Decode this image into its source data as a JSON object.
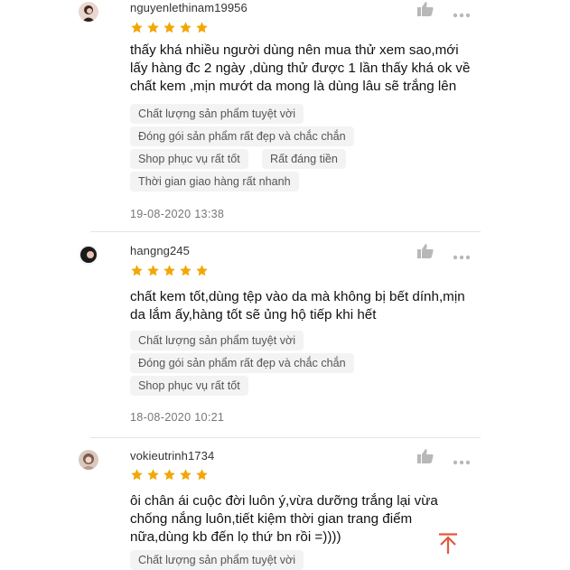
{
  "colors": {
    "star": "#f2a705",
    "icon": "#b8b8b8",
    "scroll_top": "#e0593a"
  },
  "reviews": [
    {
      "username": "nguyenlethinam19956",
      "rating": 5,
      "content": [
        "thấy khá nhiều người dùng nên mua thử xem sao,mới",
        "lấy hàng đc 2 ngày ,dùng thử được 1 lần thấy khá ok về",
        "chất kem ,mịn mướt da mong là dùng lâu sẽ trắng lên"
      ],
      "tags": [
        "Chất lượng sản phẩm tuyệt vời",
        "Đóng gói sản phẩm rất đẹp và chắc chắn",
        "Shop phục vụ rất tốt",
        "Rất đáng tiền",
        "Thời gian giao hàng rất nhanh"
      ],
      "date": "19-08-2020 13:38"
    },
    {
      "username": "hangng245",
      "rating": 5,
      "content": [
        "chất kem tốt,dùng tệp vào da mà không bị bết dính,mịn",
        "da lắm ấy,hàng tốt sẽ ủng hộ tiếp khi hết"
      ],
      "tags": [
        "Chất lượng sản phẩm tuyệt vời",
        "Đóng gói sản phẩm rất đẹp và chắc chắn",
        "Shop phục vụ rất tốt"
      ],
      "date": "18-08-2020 10:21"
    },
    {
      "username": "vokieutrinh1734",
      "rating": 5,
      "content": [
        "ôi chân ái cuộc đời luôn ý,vừa dưỡng trắng lại vừa",
        "chống nắng luôn,tiết kiệm thời gian trang điểm",
        "nữa,dùng kb đến lọ thứ bn rồi =))))"
      ],
      "tags": [
        "Chất lượng sản phẩm tuyệt vời"
      ]
    }
  ]
}
